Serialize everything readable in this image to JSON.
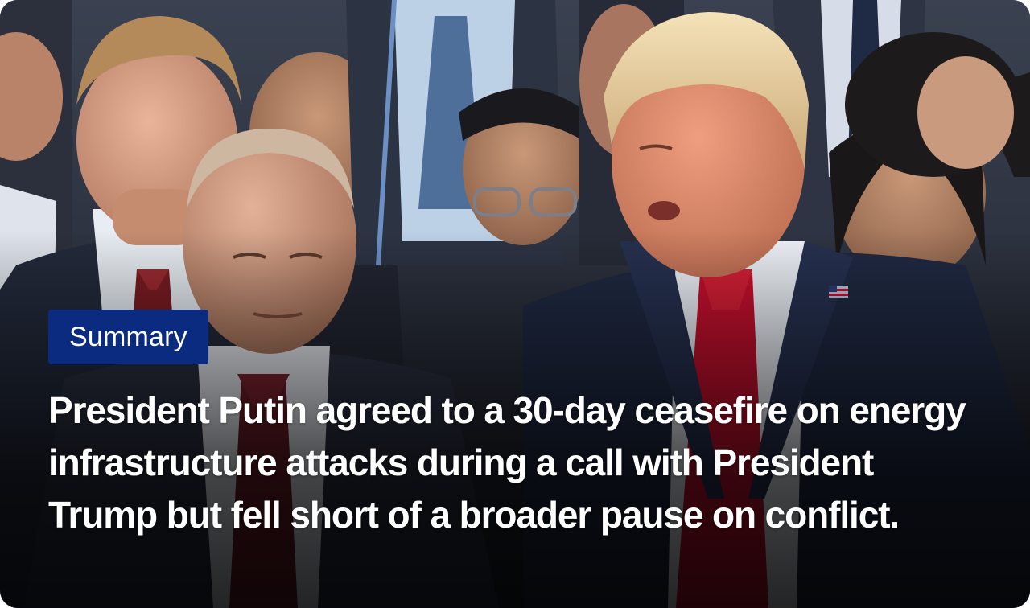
{
  "card": {
    "badge_label": "Summary",
    "headline": "President Putin agreed to a 30-day ceasefire on energy infrastructure attacks during a call with President Trump but fell short of a broader pause on conflict."
  },
  "photo": {
    "subject": "photo-icon"
  },
  "colors": {
    "badge_background": "#0b2b80",
    "text": "#ffffff",
    "tie_red": "#c8102e",
    "suit_navy": "#1c2740"
  }
}
